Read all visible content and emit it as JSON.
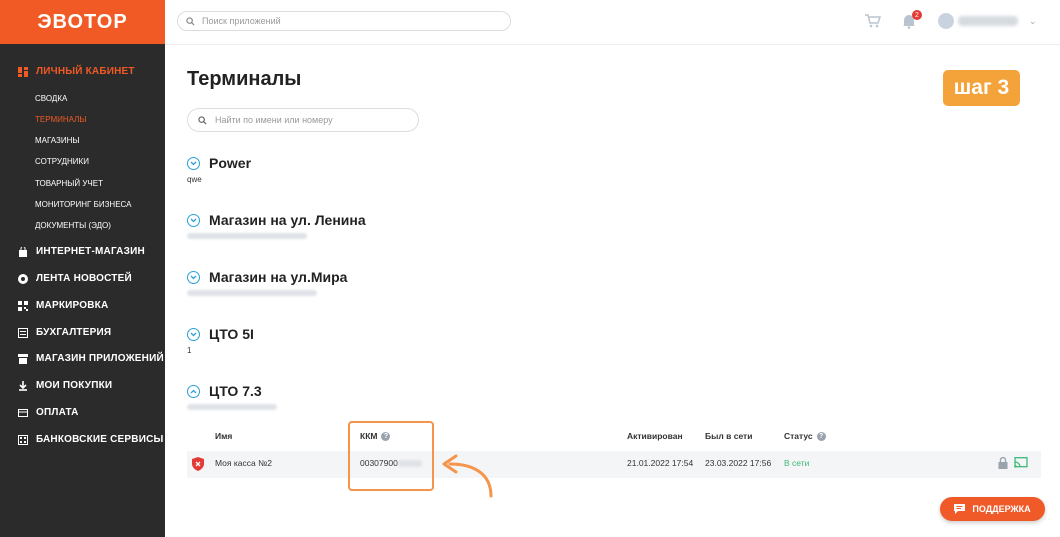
{
  "logo": "ЭВОТОР",
  "sidebar": {
    "sections": [
      {
        "label": "ЛИЧНЫЙ КАБИНЕТ",
        "icon": "dashboard-icon",
        "active": true
      },
      {
        "label": "ИНТЕРНЕТ-МАГАЗИН",
        "icon": "shopping-bag-icon"
      },
      {
        "label": "ЛЕНТА НОВОСТЕЙ",
        "icon": "news-icon"
      },
      {
        "label": "МАРКИРОВКА",
        "icon": "barcode-icon"
      },
      {
        "label": "БУХГАЛТЕРИЯ",
        "icon": "accounting-icon"
      },
      {
        "label": "МАГАЗИН ПРИЛОЖЕНИЙ",
        "icon": "store-icon"
      },
      {
        "label": "МОИ ПОКУПКИ",
        "icon": "download-icon"
      },
      {
        "label": "ОПЛАТА",
        "icon": "card-icon"
      },
      {
        "label": "БАНКОВСКИЕ СЕРВИСЫ",
        "icon": "bank-icon"
      }
    ],
    "sub_items": [
      {
        "label": "СВОДКА"
      },
      {
        "label": "ТЕРМИНАЛЫ",
        "active": true
      },
      {
        "label": "МАГАЗИНЫ"
      },
      {
        "label": "СОТРУДНИКИ"
      },
      {
        "label": "ТОВАРНЫЙ УЧЕТ"
      },
      {
        "label": "МОНИТОРИНГ БИЗНЕСА"
      },
      {
        "label": "ДОКУМЕНТЫ (ЭДО)"
      }
    ]
  },
  "topbar": {
    "search_placeholder": "Поиск приложений",
    "notification_count": "2"
  },
  "page": {
    "title": "Терминалы",
    "step_label": "шаг 3",
    "search_placeholder": "Найти по имени или номеру"
  },
  "groups": [
    {
      "name": "Power",
      "address": "qwe",
      "expanded": false
    },
    {
      "name": "Магазин на ул. Ленина",
      "address": "",
      "expanded": false
    },
    {
      "name": "Магазин на ул.Мира",
      "address": "",
      "expanded": false
    },
    {
      "name": "ЦТО 5I",
      "address": "1",
      "expanded": false
    },
    {
      "name": "ЦТО 7.3",
      "address": "",
      "expanded": true
    }
  ],
  "table": {
    "headers": {
      "name": "Имя",
      "kkm": "ККМ",
      "activated": "Активирован",
      "last_online": "Был в сети",
      "status": "Статус"
    },
    "rows": [
      {
        "name": "Моя касса №2",
        "kkm": "00307900",
        "activated": "21.01.2022 17:54",
        "last_online": "23.03.2022 17:56",
        "status": "В сети"
      }
    ]
  },
  "support_label": "ПОДДЕРЖКА",
  "colors": {
    "brand": "#f15a24",
    "sidebar": "#2b2b2b",
    "accent": "#2a9fd8",
    "online": "#3cb878",
    "step": "#f4a23a"
  }
}
